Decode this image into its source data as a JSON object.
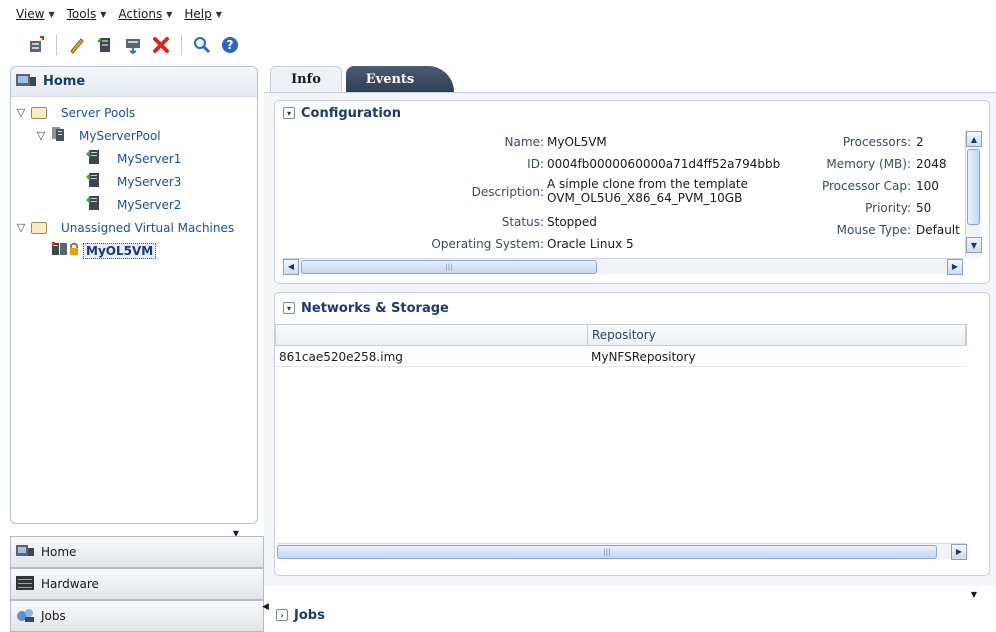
{
  "menubar": [
    {
      "label": "View"
    },
    {
      "label": "Tools"
    },
    {
      "label": "Actions"
    },
    {
      "label": "Help"
    }
  ],
  "toolbar": {
    "icons": [
      "create-vm-icon",
      "edit-icon",
      "clone-icon",
      "migrate-icon",
      "delete-icon",
      "search-icon",
      "help-icon"
    ]
  },
  "left_panel": {
    "title": "Home",
    "tree": {
      "server_pools": "Server Pools",
      "pool": "MyServerPool",
      "servers": [
        "MyServer1",
        "MyServer3",
        "MyServer2"
      ],
      "unassigned": "Unassigned Virtual Machines",
      "vm": "MyOL5VM"
    }
  },
  "accordion": [
    {
      "label": "Home"
    },
    {
      "label": "Hardware"
    },
    {
      "label": "Jobs"
    }
  ],
  "tabs": [
    {
      "label": "Info"
    },
    {
      "label": "Events"
    }
  ],
  "configuration": {
    "title": "Configuration",
    "left": [
      {
        "label": "Name:",
        "value": "MyOL5VM"
      },
      {
        "label": "ID:",
        "value": "0004fb0000060000a71d4ff52a794bbb"
      },
      {
        "label": "Description:",
        "value_line1": "A simple clone from the template",
        "value_line2": "OVM_OL5U6_X86_64_PVM_10GB"
      },
      {
        "label": "Status:",
        "value": "Stopped"
      },
      {
        "label": "Operating System:",
        "value": "Oracle Linux 5"
      }
    ],
    "right": [
      {
        "label": "Processors:",
        "value": "2"
      },
      {
        "label": "Memory (MB):",
        "value": "2048"
      },
      {
        "label": "Processor Cap:",
        "value": "100"
      },
      {
        "label": "Priority:",
        "value": "50"
      },
      {
        "label": "Mouse Type:",
        "value": "Default"
      }
    ]
  },
  "networks": {
    "title": "Networks & Storage",
    "columns": [
      "",
      "Repository"
    ],
    "rows": [
      {
        "file": "861cae520e258.img",
        "repo": "MyNFSRepository"
      }
    ]
  },
  "jobs_bar": {
    "title": "Jobs"
  },
  "colors": {
    "accent": "#1d3a6b",
    "link": "#1b4e9c",
    "events_tab": "#3a4b63"
  }
}
